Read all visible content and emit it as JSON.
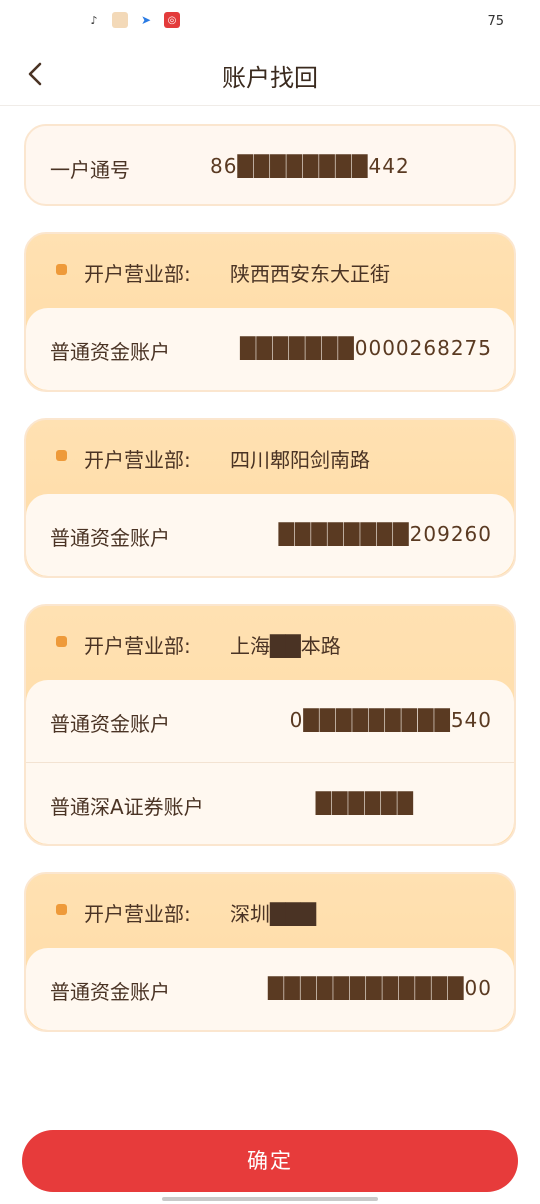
{
  "status_bar": {
    "icons": [
      "tiktok-icon",
      "app-icon",
      "send-icon",
      "netease-icon"
    ],
    "number": "75"
  },
  "header": {
    "title": "账户找回",
    "back_icon": "chevron-left-icon"
  },
  "account_id": {
    "label": "一户通号",
    "value": "86████████442"
  },
  "branches": [
    {
      "label": "开户营业部:",
      "name": "陕西西安东大正街",
      "accounts": [
        {
          "label": "普通资金账户",
          "value": "███████0000268275"
        }
      ]
    },
    {
      "label": "开户营业部:",
      "name": "四川郫阳剑南路",
      "accounts": [
        {
          "label": "普通资金账户",
          "value": "████████209260"
        }
      ]
    },
    {
      "label": "开户营业部:",
      "name": "上海██本路",
      "accounts": [
        {
          "label": "普通资金账户",
          "value": "0█████████540"
        },
        {
          "label": "普通深A证券账户",
          "value": "██████"
        }
      ]
    },
    {
      "label": "开户营业部:",
      "name": "深圳███",
      "accounts": [
        {
          "label": "普通资金账户",
          "value": "████████████00"
        }
      ]
    }
  ],
  "confirm_button": {
    "label": "确定"
  },
  "colors": {
    "accent": "#e73b3b",
    "card_header": "#ffdda8",
    "card_body": "#fff8f0",
    "text": "#4a3324"
  }
}
